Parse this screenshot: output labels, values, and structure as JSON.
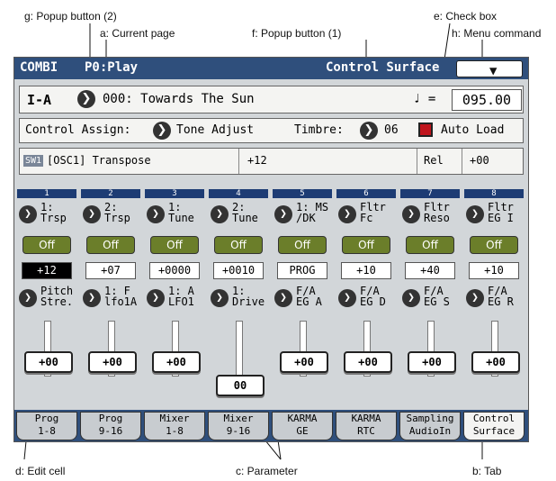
{
  "annotations": {
    "g": "g: Popup button (2)",
    "a": "a: Current page",
    "f": "f: Popup button (1)",
    "e": "e: Check box",
    "h": "h: Menu command",
    "d": "d: Edit cell",
    "c": "c: Parameter",
    "b": "b: Tab"
  },
  "titlebar": {
    "mode": "COMBI",
    "page": "P0:Play",
    "section": "Control Surface",
    "menu_icon": "chevron-down-icon"
  },
  "program_row": {
    "bank": "I-A",
    "number_name": "000: Towards The Sun",
    "tempo_label": "♩ =",
    "tempo": "095.00"
  },
  "assign_row": {
    "label": "Control Assign:",
    "value": "Tone Adjust",
    "timbre_label": "Timbre:",
    "timbre_value": "06",
    "auto_load": "Auto Load"
  },
  "info_row": {
    "tag": "SW1",
    "param": "[OSC1] Transpose",
    "value": "+12",
    "mode": "Rel",
    "offset": "+00"
  },
  "columns": [
    {
      "num": "1",
      "p1a": "1:",
      "p1b": "Trsp",
      "sw": "Off",
      "val": "+12",
      "p2a": "Pitch",
      "p2b": "Stre.",
      "knob": "+00"
    },
    {
      "num": "2",
      "p1a": "2:",
      "p1b": "Trsp",
      "sw": "Off",
      "val": "+07",
      "p2a": "1: F",
      "p2b": "lfo1A",
      "knob": "+00"
    },
    {
      "num": "3",
      "p1a": "1:",
      "p1b": "Tune",
      "sw": "Off",
      "val": "+0000",
      "p2a": "1: A",
      "p2b": "LFO1",
      "knob": "+00"
    },
    {
      "num": "4",
      "p1a": "2:",
      "p1b": "Tune",
      "sw": "Off",
      "val": "+0010",
      "p2a": "1:",
      "p2b": "Drive",
      "knob": "00"
    },
    {
      "num": "5",
      "p1a": "1: MS",
      "p1b": "/DK",
      "sw": "Off",
      "val": "PROG",
      "p2a": "F/A",
      "p2b": "EG A",
      "knob": "+00"
    },
    {
      "num": "6",
      "p1a": "Fltr",
      "p1b": "Fc",
      "sw": "Off",
      "val": "+10",
      "p2a": "F/A",
      "p2b": "EG D",
      "knob": "+00"
    },
    {
      "num": "7",
      "p1a": "Fltr",
      "p1b": "Reso",
      "sw": "Off",
      "val": "+40",
      "p2a": "F/A",
      "p2b": "EG S",
      "knob": "+00"
    },
    {
      "num": "8",
      "p1a": "Fltr",
      "p1b": "EG I",
      "sw": "Off",
      "val": "+10",
      "p2a": "F/A",
      "p2b": "EG R",
      "knob": "+00"
    }
  ],
  "tabs": [
    {
      "l1": "Prog",
      "l2": "1-8"
    },
    {
      "l1": "Prog",
      "l2": "9-16"
    },
    {
      "l1": "Mixer",
      "l2": "1-8"
    },
    {
      "l1": "Mixer",
      "l2": "9-16"
    },
    {
      "l1": "KARMA",
      "l2": "GE"
    },
    {
      "l1": "KARMA",
      "l2": "RTC"
    },
    {
      "l1": "Sampling",
      "l2": "AudioIn"
    },
    {
      "l1": "Control",
      "l2": "Surface"
    }
  ],
  "colors": {
    "titlebar": "#2f4f7c",
    "switch": "#6b7e2a",
    "checkbox": "#c0141c"
  }
}
